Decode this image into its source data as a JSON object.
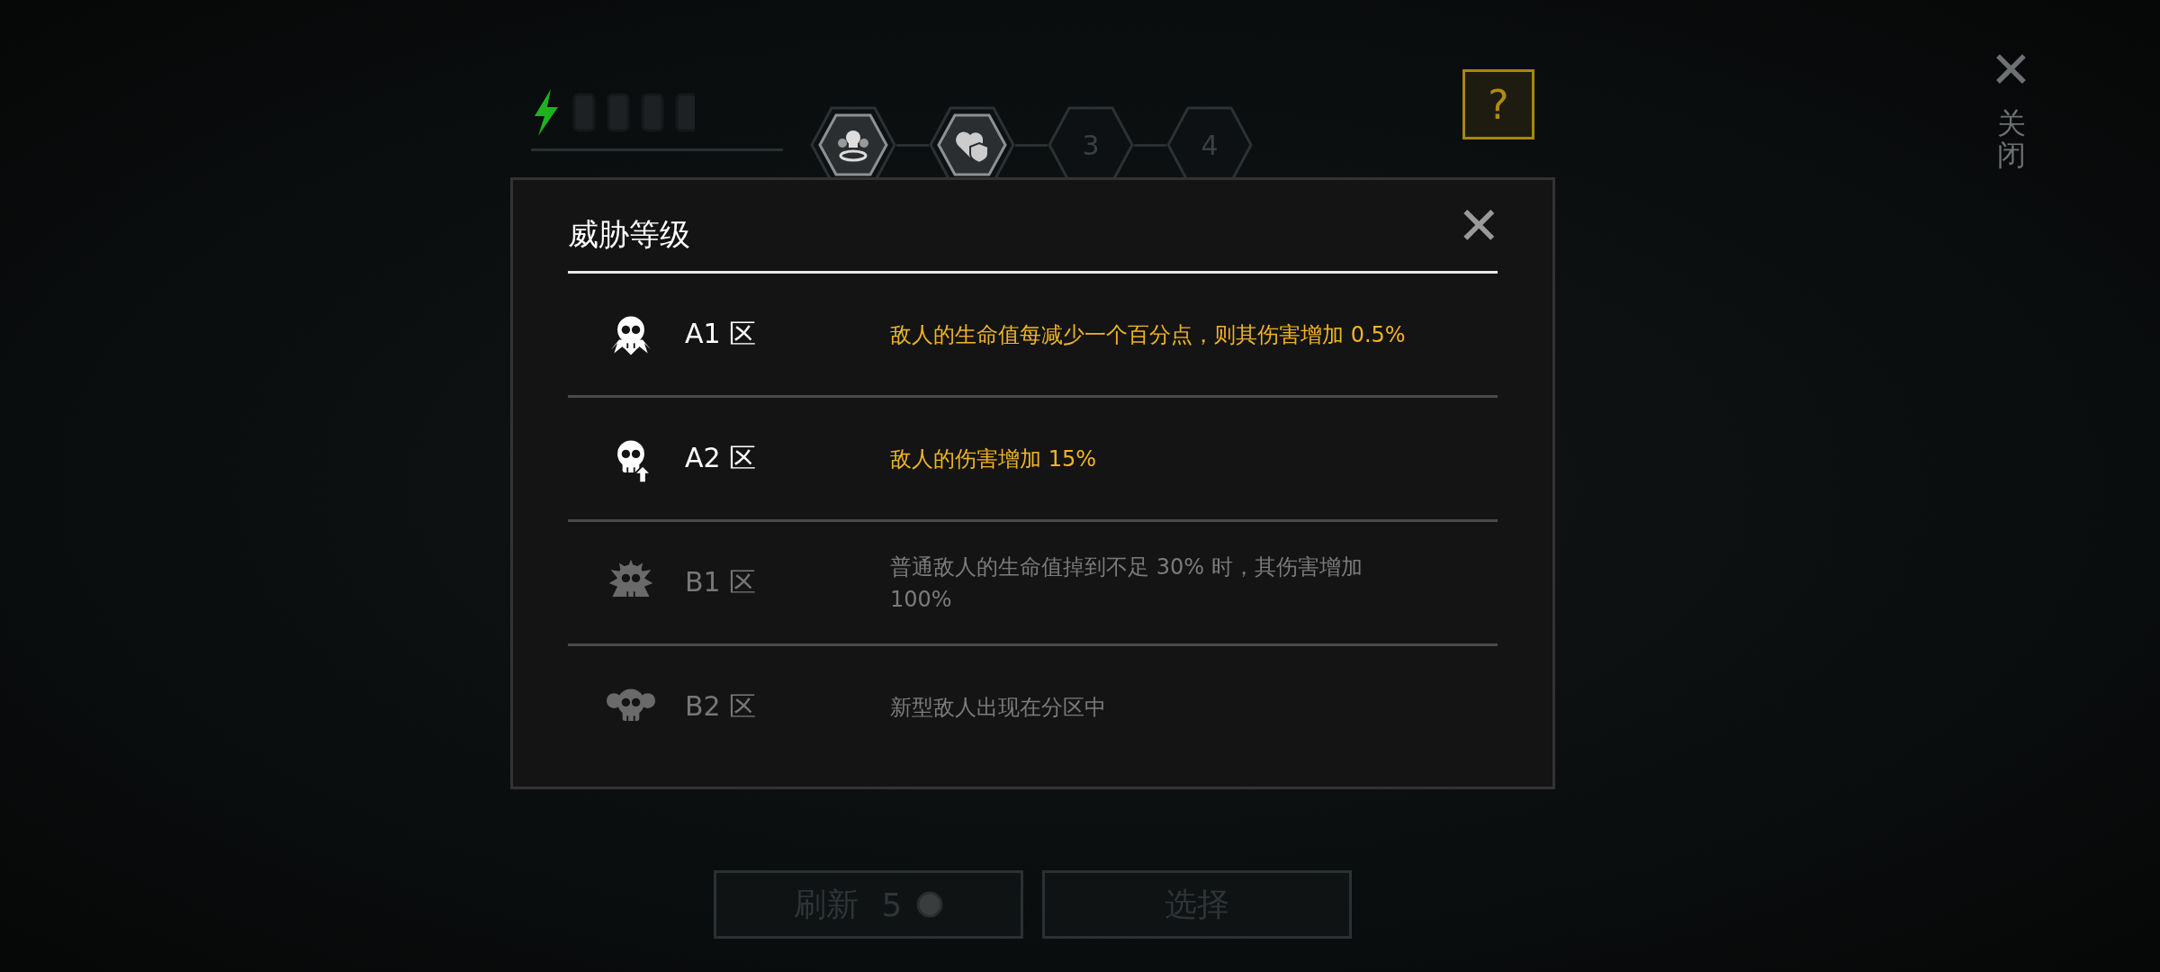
{
  "stages": [
    {
      "kind": "icon"
    },
    {
      "kind": "icon"
    },
    {
      "kind": "number",
      "label": "3"
    },
    {
      "kind": "number",
      "label": "4"
    }
  ],
  "help": {
    "label": "?"
  },
  "side_close": {
    "icon": "✕",
    "label": "关闭"
  },
  "dialog": {
    "title": "威胁等级",
    "close": "✕",
    "rows": [
      {
        "zone": "A1 区",
        "description": "敌人的生命值每减少一个百分点，则其伤害增加 0.5%",
        "active": true
      },
      {
        "zone": "A2 区",
        "description": "敌人的伤害增加 15%",
        "active": true
      },
      {
        "zone": "B1 区",
        "description": "普通敌人的生命值掉到不足 30% 时，其伤害增加 100%",
        "active": false
      },
      {
        "zone": "B2 区",
        "description": "新型敌人出现在分区中",
        "active": false
      }
    ]
  },
  "buttons": [
    {
      "kind": "cost",
      "label": "刷新",
      "cost": "5",
      "disabled": true
    },
    {
      "kind": "plain",
      "label": "选择",
      "disabled": true
    }
  ]
}
